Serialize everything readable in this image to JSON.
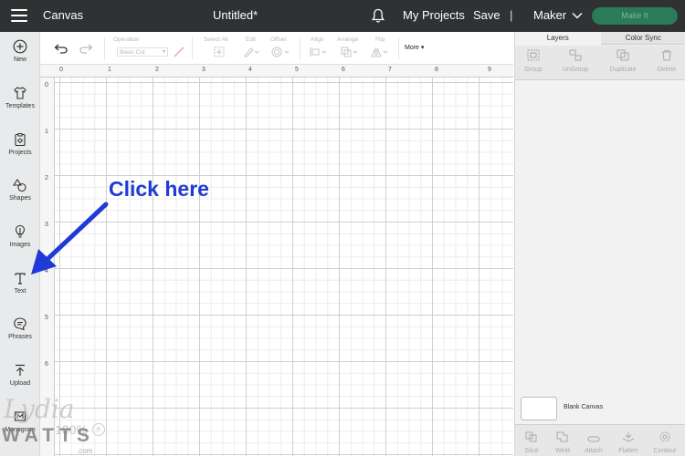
{
  "topbar": {
    "app_title": "Canvas",
    "doc_title": "Untitled*",
    "my_projects": "My Projects",
    "save": "Save",
    "separator": "|",
    "machine": "Maker",
    "make_it": "Make It"
  },
  "sidebar": {
    "items": [
      {
        "label": "New",
        "icon": "plus-circle-icon"
      },
      {
        "label": "Templates",
        "icon": "shirt-icon"
      },
      {
        "label": "Projects",
        "icon": "project-icon"
      },
      {
        "label": "Shapes",
        "icon": "shapes-icon"
      },
      {
        "label": "Images",
        "icon": "lightbulb-icon"
      },
      {
        "label": "Text",
        "icon": "text-icon"
      },
      {
        "label": "Phrases",
        "icon": "speech-bubble-icon"
      },
      {
        "label": "Upload",
        "icon": "upload-icon"
      },
      {
        "label": "Monogram",
        "icon": "monogram-icon"
      }
    ]
  },
  "toolbar": {
    "operation_label": "Operation",
    "operation_value": "Basic Cut",
    "select_all": "Select All",
    "edit": "Edit",
    "offset": "Offset",
    "align": "Align",
    "arrange": "Arrange",
    "flip": "Flip",
    "more": "More"
  },
  "rulers": {
    "top": [
      "0",
      "1",
      "2",
      "3",
      "4",
      "5",
      "6",
      "7",
      "8",
      "9"
    ],
    "left": [
      "0",
      "1",
      "2",
      "3",
      "4",
      "5",
      "6"
    ]
  },
  "canvas": {
    "callout": "Click here",
    "zoom": "100%"
  },
  "right_panel": {
    "tabs": [
      "Layers",
      "Color Sync"
    ],
    "tools": [
      "Group",
      "UnGroup",
      "Duplicate",
      "Delete"
    ],
    "blank_canvas": "Blank Canvas",
    "bottom_tools": [
      "Slice",
      "Weld",
      "Attach",
      "Flatten",
      "Contour"
    ]
  },
  "watermark": {
    "script": "Lydia",
    "caps": "WATTS",
    "com": ".com"
  },
  "colors": {
    "topbar_bg": "#2f3133",
    "make_it_bg": "#2b7a5a",
    "callout": "#1f3ad6"
  }
}
